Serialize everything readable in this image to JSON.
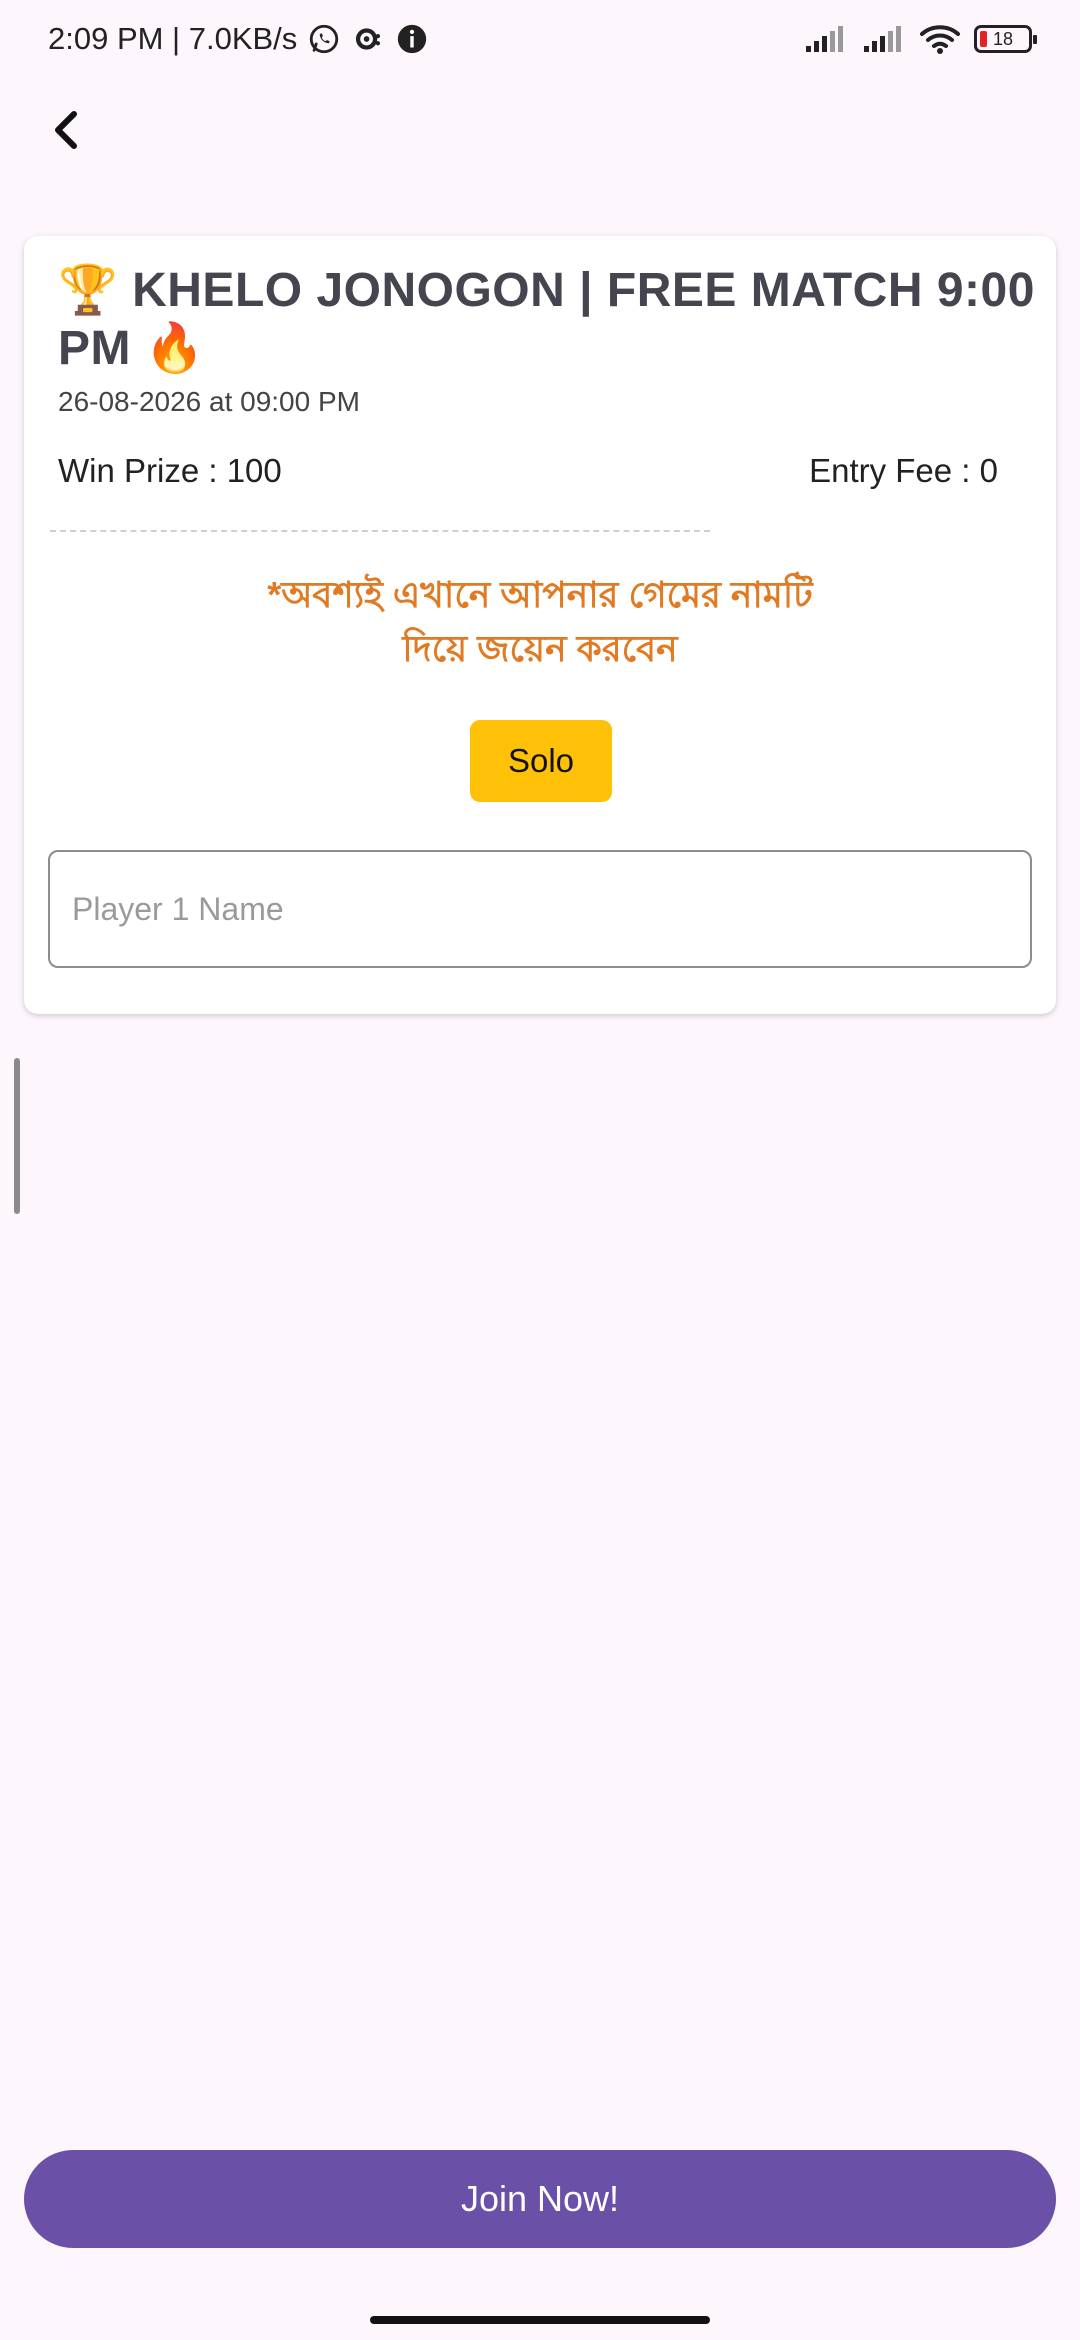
{
  "status_bar": {
    "time_speed": "2:09 PM | 7.0KB/s",
    "battery_level": "18",
    "icons": [
      "whatsapp-icon",
      "sync-icon",
      "info-icon",
      "signal-icon",
      "signal-icon",
      "wifi-icon",
      "battery-icon"
    ]
  },
  "nav": {
    "back_icon": "chevron-left-icon"
  },
  "match": {
    "title": "🏆 KHELO JONOGON | FREE MATCH 9:00 PM 🔥",
    "datetime": "26-08-2026 at 09:00 PM",
    "win_prize": "Win Prize : 100",
    "entry_fee": "Entry Fee : 0",
    "notice_line1": "*অবশ্যই এখানে আপনার গেমের নামটি",
    "notice_line2": "দিয়ে জয়েন করবেন",
    "mode_label": "Solo",
    "player_placeholder": "Player 1 Name"
  },
  "footer": {
    "join_label": "Join Now!"
  },
  "colors": {
    "background": "#fdf6fd",
    "notice": "#e07b24",
    "mode_button": "#ffc107",
    "join_button": "#6a50a7",
    "title": "#454550"
  }
}
